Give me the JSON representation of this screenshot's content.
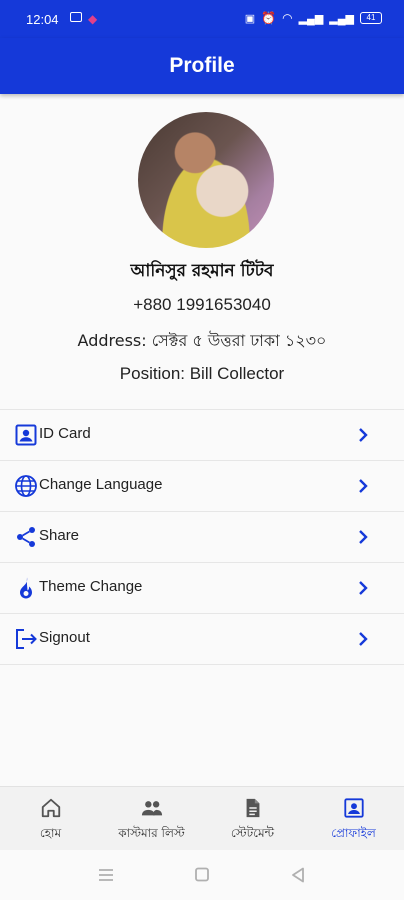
{
  "status_bar": {
    "time": "12:04",
    "battery": "41"
  },
  "app_bar": {
    "title": "Profile"
  },
  "profile": {
    "name": "আনিসুর রহমান টিটব",
    "phone": "+880 1991653040",
    "address": "Address: সেক্টর ৫ উত্তরা ঢাকা ১২৩০",
    "position": "Position: Bill Collector"
  },
  "menu": [
    {
      "label": "ID Card",
      "icon": "id-card-icon"
    },
    {
      "label": "Change Language",
      "icon": "globe-icon"
    },
    {
      "label": "Share",
      "icon": "share-icon"
    },
    {
      "label": "Theme Change",
      "icon": "flame-icon"
    },
    {
      "label": "Signout",
      "icon": "signout-icon"
    }
  ],
  "bottom_nav": [
    {
      "label": "হোম",
      "icon": "home-icon",
      "active": false
    },
    {
      "label": "কাস্টমার লিস্ট",
      "icon": "people-icon",
      "active": false
    },
    {
      "label": "স্টেটমেন্ট",
      "icon": "document-icon",
      "active": false
    },
    {
      "label": "প্রোফাইল",
      "icon": "profile-icon",
      "active": true
    }
  ],
  "colors": {
    "primary": "#1539d9",
    "background": "#fafafa",
    "text": "#222222"
  }
}
